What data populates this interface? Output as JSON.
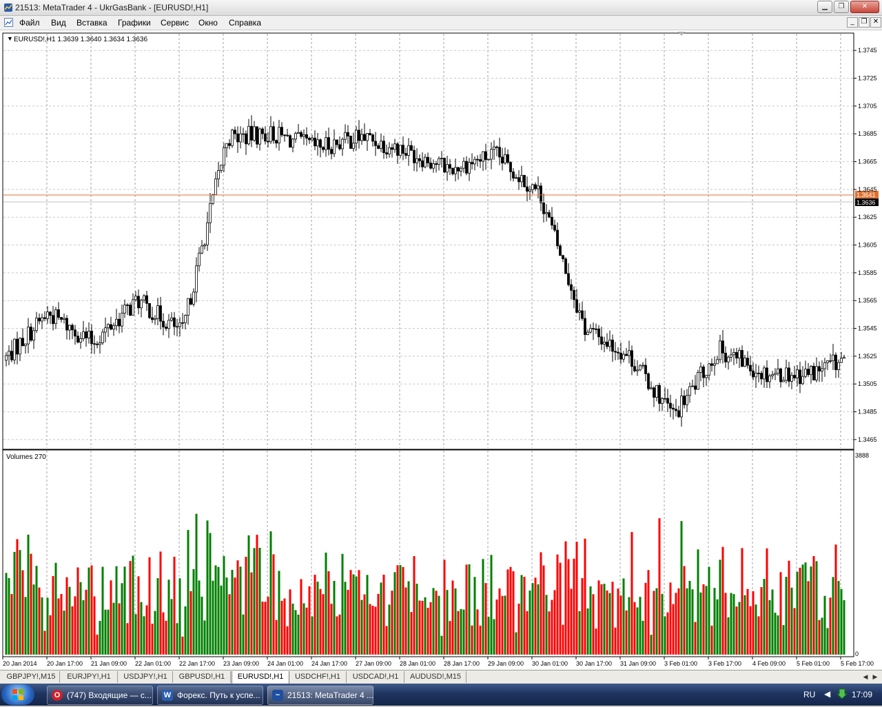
{
  "window": {
    "title": "21513: MetaTrader 4 - UkrGasBank - [EURUSD!,H1]"
  },
  "menu": [
    "Файл",
    "Вид",
    "Вставка",
    "Графики",
    "Сервис",
    "Окно",
    "Справка"
  ],
  "chart": {
    "header": "EURUSD!,H1  1.3639 1.3640 1.3634 1.3636",
    "volume_label": "Volumes 270",
    "price_ticks": [
      "1.3745",
      "1.3725",
      "1.3705",
      "1.3685",
      "1.3665",
      "1.3645",
      "1.3625",
      "1.3605",
      "1.3585",
      "1.3565",
      "1.3545",
      "1.3525",
      "1.3505",
      "1.3485",
      "1.3465"
    ],
    "volume_ticks": [
      "3888",
      "0"
    ],
    "bid_label": "1.3636",
    "ask_label": "1.3641",
    "time_labels": [
      "20 Jan 2014",
      "20 Jan 17:00",
      "21 Jan 09:00",
      "22 Jan 01:00",
      "22 Jan 17:00",
      "23 Jan 09:00",
      "24 Jan 01:00",
      "24 Jan 17:00",
      "27 Jan 09:00",
      "28 Jan 01:00",
      "28 Jan 17:00",
      "29 Jan 09:00",
      "30 Jan 01:00",
      "30 Jan 17:00",
      "31 Jan 09:00",
      "3 Feb 01:00",
      "3 Feb 17:00",
      "4 Feb 09:00",
      "5 Feb 01:00",
      "5 Feb 17:00"
    ],
    "colors": {
      "candle": "#000000",
      "grid": "#a0a0a0",
      "ask_line": "#e07030",
      "bid_line": "#c0c0c0",
      "vol_up": "#008000",
      "vol_down": "#ff0000"
    }
  },
  "chart_data": {
    "type": "candlestick",
    "symbol": "EURUSD!",
    "timeframe": "H1",
    "ohlc_last": {
      "open": 1.3639,
      "high": 1.364,
      "low": 1.3634,
      "close": 1.3636
    },
    "ylim": [
      1.3459,
      1.3757
    ],
    "bid": 1.3636,
    "ask": 1.3641,
    "volume_ylim": [
      0,
      3888
    ],
    "volume_last": 270,
    "close_trend": [
      {
        "t": "20 Jan 2014",
        "price": 1.3522
      },
      {
        "t": "20 Jan 17:00",
        "price": 1.3556
      },
      {
        "t": "21 Jan 09:00",
        "price": 1.3535
      },
      {
        "t": "22 Jan 01:00",
        "price": 1.3565
      },
      {
        "t": "22 Jan 17:00",
        "price": 1.3542
      },
      {
        "t": "23 Jan 09:00",
        "price": 1.3682
      },
      {
        "t": "24 Jan 01:00",
        "price": 1.3685
      },
      {
        "t": "24 Jan 17:00",
        "price": 1.3675
      },
      {
        "t": "27 Jan 09:00",
        "price": 1.3683
      },
      {
        "t": "28 Jan 01:00",
        "price": 1.3673
      },
      {
        "t": "28 Jan 17:00",
        "price": 1.366
      },
      {
        "t": "29 Jan 09:00",
        "price": 1.367
      },
      {
        "t": "30 Jan 01:00",
        "price": 1.3642
      },
      {
        "t": "30 Jan 17:00",
        "price": 1.3545
      },
      {
        "t": "31 Jan 09:00",
        "price": 1.3525
      },
      {
        "t": "3 Feb 01:00",
        "price": 1.3482
      },
      {
        "t": "3 Feb 17:00",
        "price": 1.353
      },
      {
        "t": "4 Feb 09:00",
        "price": 1.3513
      },
      {
        "t": "5 Feb 01:00",
        "price": 1.3512
      },
      {
        "t": "5 Feb 17:00",
        "price": 1.3525
      }
    ]
  },
  "tabs": [
    "GBPJPY!,M15",
    "EURJPY!,H1",
    "USDJPY!,H1",
    "GBPUSD!,H1",
    "EURUSD!,H1",
    "USDCHF!,H1",
    "USDCAD!,H1",
    "AUDUSD!,M15"
  ],
  "active_tab": "EURUSD!,H1",
  "taskbar": {
    "items": [
      {
        "label": "(747) Входящие — с...",
        "icon": "O"
      },
      {
        "label": "Форекс. Путь к успе...",
        "icon": "W"
      },
      {
        "label": "21513: MetaTrader 4 ...",
        "icon": "~"
      }
    ],
    "lang": "RU",
    "time": "17:09"
  }
}
